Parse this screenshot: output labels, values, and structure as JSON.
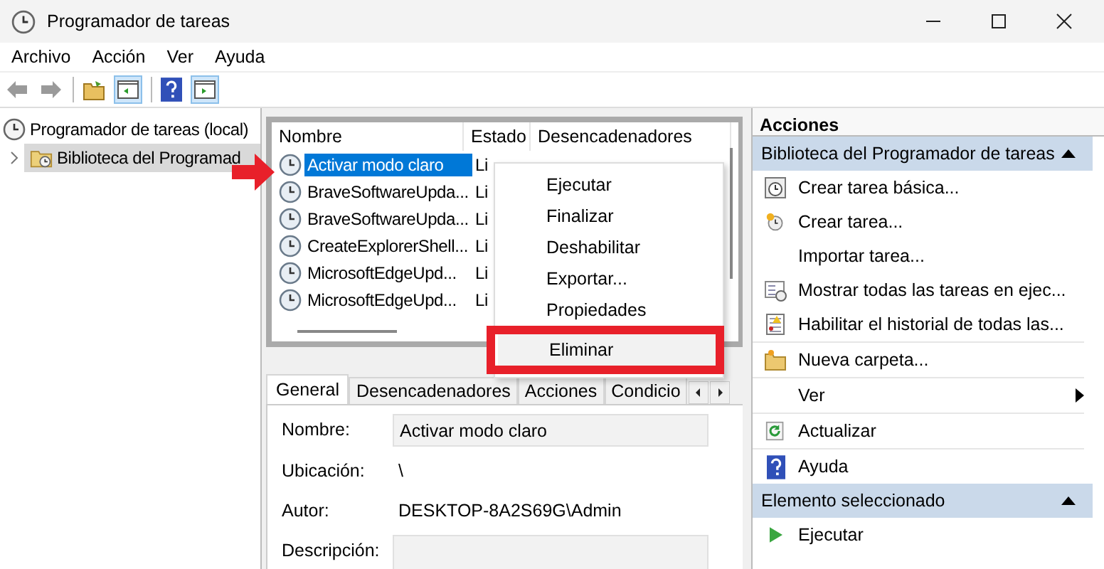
{
  "window": {
    "title": "Programador de tareas"
  },
  "menu": [
    "Archivo",
    "Acción",
    "Ver",
    "Ayuda"
  ],
  "tree": [
    {
      "label": "Programador de tareas (local)",
      "selected": false,
      "children": [
        {
          "label": "Biblioteca del Programad",
          "selected": true,
          "expanded": false
        }
      ]
    }
  ],
  "task_list": {
    "columns": [
      "Nombre",
      "Estado",
      "Desencadenadores"
    ],
    "rows": [
      {
        "name": "Activar modo claro",
        "status": "Li",
        "selected": true
      },
      {
        "name": "BraveSoftwareUpda...",
        "status": "Li",
        "selected": false
      },
      {
        "name": "BraveSoftwareUpda...",
        "status": "Li",
        "selected": false
      },
      {
        "name": "CreateExplorerShell...",
        "status": "Li",
        "selected": false
      },
      {
        "name": "MicrosoftEdgeUpd...",
        "status": "Li",
        "selected": false
      },
      {
        "name": "MicrosoftEdgeUpd...",
        "status": "Li",
        "selected": false
      }
    ]
  },
  "context_menu": {
    "items": [
      {
        "label": "Ejecutar",
        "highlighted": false
      },
      {
        "label": "Finalizar",
        "highlighted": false
      },
      {
        "label": "Deshabilitar",
        "highlighted": false
      },
      {
        "label": "Exportar...",
        "highlighted": false
      },
      {
        "label": "Propiedades",
        "highlighted": false
      },
      {
        "label": "Eliminar",
        "highlighted": true
      }
    ]
  },
  "detail_tabs": [
    {
      "label": "General",
      "selected": true
    },
    {
      "label": "Desencadenadores",
      "selected": false
    },
    {
      "label": "Acciones",
      "selected": false
    },
    {
      "label": "Condicio",
      "selected": false
    }
  ],
  "details": [
    {
      "label": "Nombre:",
      "value": "Activar modo claro",
      "kind": "box"
    },
    {
      "label": "Ubicación:",
      "value": "\\",
      "kind": "plain"
    },
    {
      "label": "Autor:",
      "value": "DESKTOP-8A2S69G\\Admin",
      "kind": "plain"
    },
    {
      "label": "Descripción:",
      "kind": "area"
    }
  ],
  "actions": {
    "title": "Acciones",
    "sections": [
      {
        "title": "Biblioteca del Programador de tareas",
        "expanded": true,
        "items": [
          {
            "label": "Crear tarea básica...",
            "submenu": false
          },
          {
            "label": "Crear tarea...",
            "submenu": false
          },
          {
            "label": "Importar tarea...",
            "submenu": false
          },
          {
            "label": "Mostrar todas las tareas en ejec...",
            "submenu": false
          },
          {
            "label": "Habilitar el historial de todas las...",
            "submenu": false
          },
          {
            "label": "Nueva carpeta...",
            "submenu": false
          },
          {
            "label": "Ver",
            "submenu": true
          },
          {
            "label": "Actualizar",
            "submenu": false
          },
          {
            "label": "Ayuda",
            "submenu": false
          }
        ]
      },
      {
        "title": "Elemento seleccionado",
        "expanded": true,
        "items": [
          {
            "label": "Ejecutar",
            "submenu": false
          }
        ]
      }
    ]
  }
}
